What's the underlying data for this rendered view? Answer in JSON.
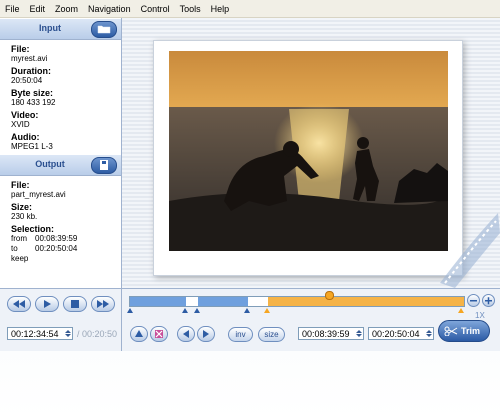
{
  "menu": [
    "File",
    "Edit",
    "Zoom",
    "Navigation",
    "Control",
    "Tools",
    "Help"
  ],
  "input": {
    "header": "Input",
    "file_label": "File:",
    "file": "myrest.avi",
    "duration_label": "Duration:",
    "duration": "20:50:04",
    "bytes_label": "Byte size:",
    "bytes": "180 433 192",
    "video_label": "Video:",
    "video": "XVID",
    "audio_label": "Audio:",
    "audio": "MPEG1 L-3"
  },
  "output": {
    "header": "Output",
    "file_label": "File:",
    "file": "part_myrest.avi",
    "size_label": "Size:",
    "size": "230 kb.",
    "selection_label": "Selection:",
    "from_label": "from",
    "from": "00:08:39:59",
    "to_label": "to",
    "to": "00:20:50:04",
    "keep": "keep"
  },
  "controls": {
    "current_time": "00:12:34:54",
    "total_time": "/ 00:20:50",
    "start_time": "00:08:39:59",
    "end_time": "00:20:50:04",
    "zoom": "1X",
    "inv_label": "inv",
    "size_label": "size",
    "trim_label": "Trim"
  },
  "colors": {
    "accent": "#2d5ca4",
    "selection": "#f5a623",
    "segment": "#6fa0de"
  }
}
